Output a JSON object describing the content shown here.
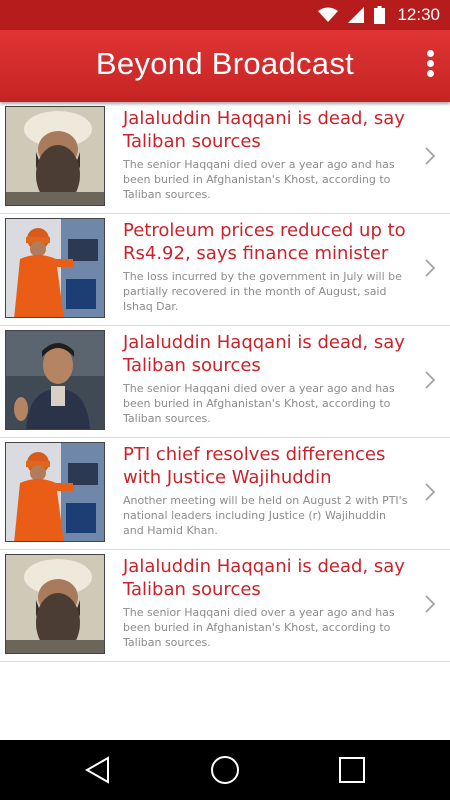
{
  "status_bar": {
    "time": "12:30",
    "icons": [
      "wifi-icon",
      "signal-icon",
      "battery-icon"
    ]
  },
  "app_bar": {
    "title": "Beyond Broadcast",
    "menu_icon": "overflow-menu-icon"
  },
  "news": [
    {
      "title": "Jalaluddin Haqqani is dead, say Taliban sources",
      "summary": "The senior Haqqani died over a year ago and has been buried in Afghanistan's Khost, according to Taliban sources.",
      "thumbnail": "bearded-man-photo"
    },
    {
      "title": "Petroleum prices reduced up to Rs4.92, says finance minister",
      "summary": "The loss incurred by the government in July will be partially recovered in the month of August, said Ishaq Dar.",
      "thumbnail": "fuel-attendant-photo"
    },
    {
      "title": "Jalaluddin Haqqani is dead, say Taliban sources",
      "summary": "The senior Haqqani died over a year ago and has been buried in Afghanistan's Khost, according to Taliban sources.",
      "thumbnail": "politician-photo"
    },
    {
      "title": "PTI chief resolves differences with Justice Wajihuddin",
      "summary": "Another meeting will be held on August 2 with PTI's national leaders including Justice (r) Wajihuddin and Hamid Khan.",
      "thumbnail": "fuel-attendant-photo"
    },
    {
      "title": "Jalaluddin Haqqani is dead, say Taliban sources",
      "summary": "The senior Haqqani died over a year ago and has been buried in Afghanistan's Khost, according to Taliban sources.",
      "thumbnail": "bearded-man-photo"
    }
  ],
  "nav_bar": {
    "buttons": [
      "back-icon",
      "home-icon",
      "recents-icon"
    ]
  },
  "colors": {
    "app_bar": "#d32f2f",
    "status_bar": "#b71c1c",
    "title_text": "#cc2229",
    "summary_text": "#8c8c8c"
  }
}
